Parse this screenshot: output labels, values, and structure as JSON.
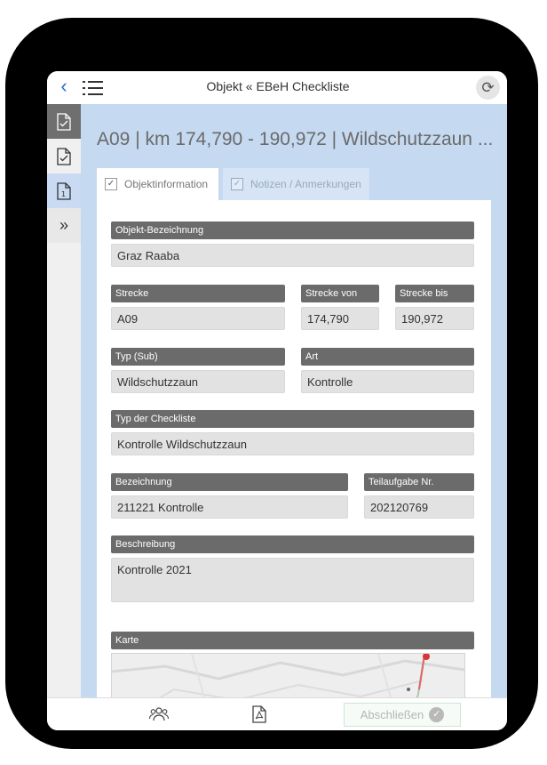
{
  "header": {
    "title": "Objekt « EBeH Checkliste",
    "back_icon": "chevron-left-icon",
    "menu_icon": "list-menu-icon",
    "sync_icon": "refresh-icon"
  },
  "rail": {
    "items": [
      {
        "icon": "document-check-icon",
        "state": "dark"
      },
      {
        "icon": "document-check-icon",
        "state": "default"
      },
      {
        "icon": "document-number-icon",
        "badge": "1",
        "state": "active"
      },
      {
        "icon": "expand-icon",
        "label": "»"
      }
    ]
  },
  "page": {
    "title": "A09 | km 174,790 - 190,972 | Wildschutzzaun ..."
  },
  "tabs": [
    {
      "label": "Objektinformation",
      "active": true
    },
    {
      "label": "Notizen / Anmerkungen",
      "active": false
    }
  ],
  "form": {
    "objekt_bezeichnung": {
      "label": "Objekt-Bezeichnung",
      "value": "Graz Raaba"
    },
    "strecke": {
      "label": "Strecke",
      "value": "A09"
    },
    "strecke_von": {
      "label": "Strecke von",
      "value": "174,790"
    },
    "strecke_bis": {
      "label": "Strecke bis",
      "value": "190,972"
    },
    "typ_sub": {
      "label": "Typ (Sub)",
      "value": "Wildschutzzaun"
    },
    "art": {
      "label": "Art",
      "value": "Kontrolle"
    },
    "typ_checkliste": {
      "label": "Typ der Checkliste",
      "value": "Kontrolle Wildschutzzaun"
    },
    "bezeichnung": {
      "label": "Bezeichnung",
      "value": "211221 Kontrolle"
    },
    "teilaufgabe": {
      "label": "Teilaufgabe Nr.",
      "value": "202120769"
    },
    "beschreibung": {
      "label": "Beschreibung",
      "value": "Kontrolle 2021"
    },
    "karte": {
      "label": "Karte"
    }
  },
  "footer": {
    "people_icon": "users-icon",
    "pdf_icon": "pdf-icon",
    "finish_label": "Abschließen",
    "finish_icon": "check-circle-icon"
  },
  "colors": {
    "accent_blue": "#2a6fcf",
    "main_bg": "#c5d9f1",
    "label_bg": "#6b6b6b",
    "field_bg": "#e2e2e2"
  }
}
